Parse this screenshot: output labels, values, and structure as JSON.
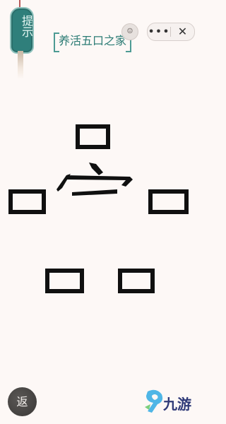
{
  "hint": {
    "label": "提示",
    "color": "#2f7f7b"
  },
  "title": {
    "text": "养活五口之家",
    "color": "#2b7b74"
  },
  "capsule": {
    "menu_label": "•••",
    "close_label": "✕"
  },
  "mini_button": {
    "label": "☺"
  },
  "puzzle": {
    "characters": [
      {
        "char": "口",
        "role": "mouth-top"
      },
      {
        "char": "宀",
        "role": "roof"
      },
      {
        "char": "口",
        "role": "mouth-left"
      },
      {
        "char": "口",
        "role": "mouth-right"
      },
      {
        "char": "口",
        "role": "mouth-bottom-left"
      },
      {
        "char": "口",
        "role": "mouth-bottom-right"
      }
    ]
  },
  "back": {
    "label": "返"
  },
  "watermark": {
    "text": "九游",
    "icon": "nine-game-logo-icon"
  }
}
